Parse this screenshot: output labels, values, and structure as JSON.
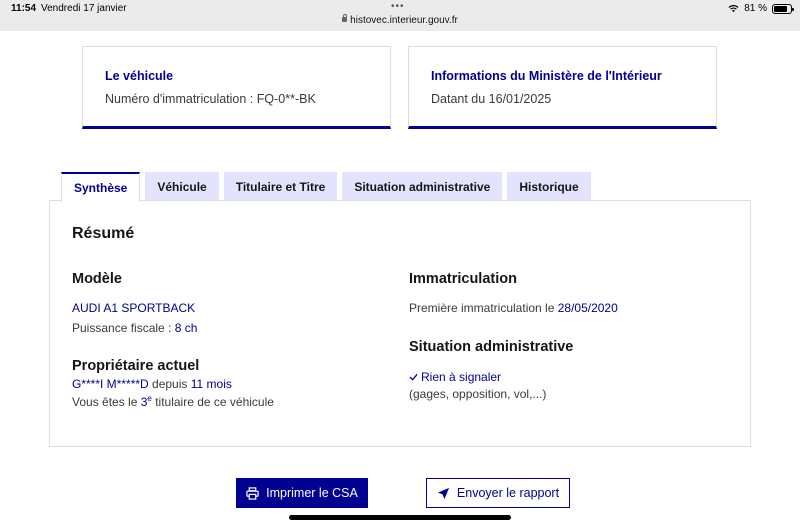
{
  "status_bar": {
    "time": "11:54",
    "date": "Vendredi 17 janvier",
    "dots": "•••",
    "url": "histovec.interieur.gouv.fr",
    "battery_percent": "81 %",
    "battery_level": 0.81,
    "icons": [
      "lock-icon",
      "wifi-icon",
      "battery-icon"
    ]
  },
  "cards": {
    "vehicle": {
      "title": "Le véhicule",
      "text": "Numéro d'immatriculation : FQ-0**-BK"
    },
    "ministry": {
      "title": "Informations du Ministère de l'Intérieur",
      "text": "Datant du 16/01/2025"
    }
  },
  "tabs": [
    {
      "label": "Synthèse",
      "active": true
    },
    {
      "label": "Véhicule",
      "active": false
    },
    {
      "label": "Titulaire et Titre",
      "active": false
    },
    {
      "label": "Situation administrative",
      "active": false
    },
    {
      "label": "Historique",
      "active": false
    }
  ],
  "summary": {
    "heading": "Résumé",
    "model": {
      "heading": "Modèle",
      "name": "AUDI A1 SPORTBACK",
      "power_label": "Puissance fiscale : ",
      "power_value": "8 ch"
    },
    "owner": {
      "heading": "Propriétaire actuel",
      "name": "G****I M*****D",
      "since_label": " depuis ",
      "since_value": "11 mois",
      "rank_prefix": "Vous êtes le ",
      "rank_number": "3",
      "rank_suffix": "e",
      "rank_end": " titulaire de ce véhicule"
    },
    "registration": {
      "heading": "Immatriculation",
      "label": "Première immatriculation le ",
      "date": "28/05/2020"
    },
    "admin": {
      "heading": "Situation administrative",
      "status": "Rien à signaler",
      "details": "(gages, opposition, vol,...)"
    }
  },
  "actions": {
    "print_label": "Imprimer le CSA",
    "send_label": "Envoyer le rapport"
  },
  "colors": {
    "accent": "#000091",
    "tab_inactive": "#e3e3fd",
    "border": "#dddddd",
    "status_bar": "#ebebeb"
  }
}
